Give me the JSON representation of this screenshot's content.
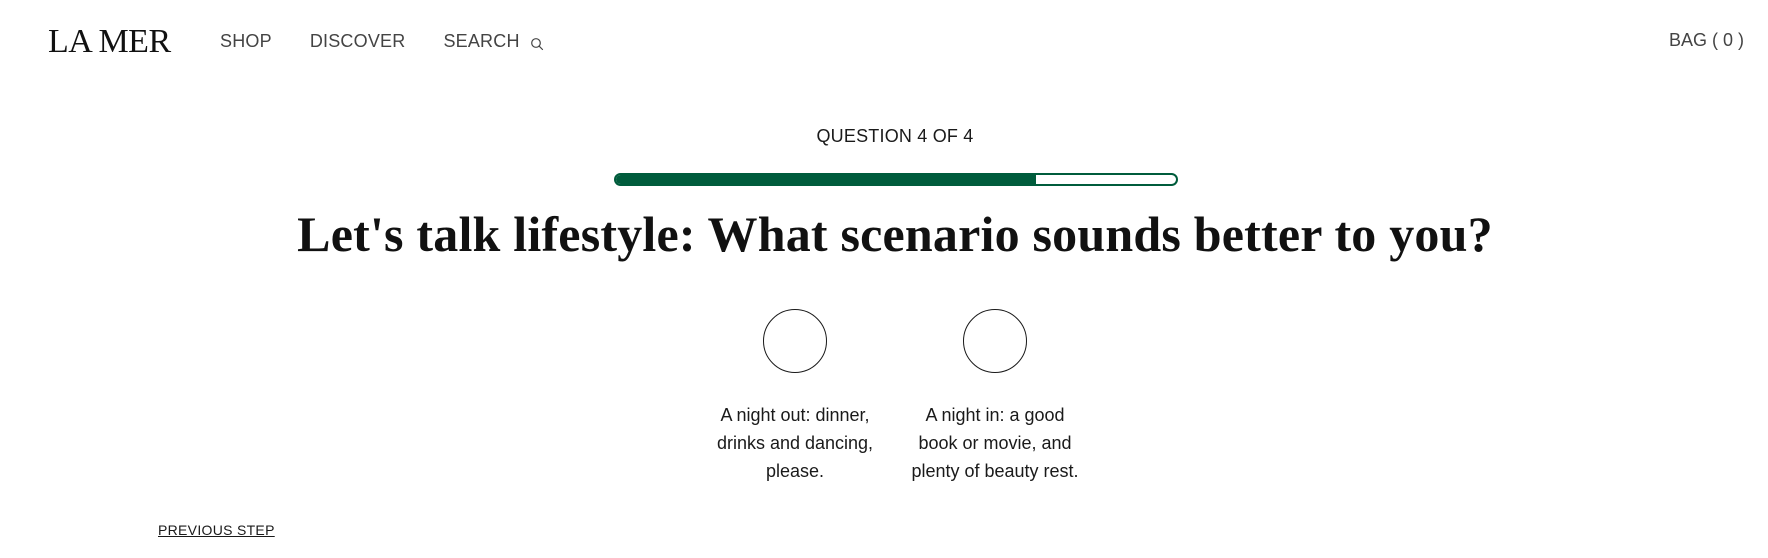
{
  "header": {
    "logo": "LA MER",
    "nav": [
      {
        "label": "SHOP"
      },
      {
        "label": "DISCOVER"
      },
      {
        "label": "SEARCH",
        "icon": "search-icon"
      }
    ],
    "bag_label": "BAG ( 0 )"
  },
  "quiz": {
    "counter": "QUESTION 4 OF 4",
    "progress_fraction": 0.75,
    "title": "Let's talk lifestyle: What scenario sounds better to you?",
    "options": [
      {
        "label": "A night out: dinner, drinks and dancing, please."
      },
      {
        "label": "A night in: a good book or movie, and plenty of beauty rest."
      }
    ],
    "previous_label": "PREVIOUS STEP"
  },
  "colors": {
    "accent": "#005c3c",
    "text": "#1a1a1a",
    "nav_text": "#444444",
    "background": "#ffffff"
  }
}
